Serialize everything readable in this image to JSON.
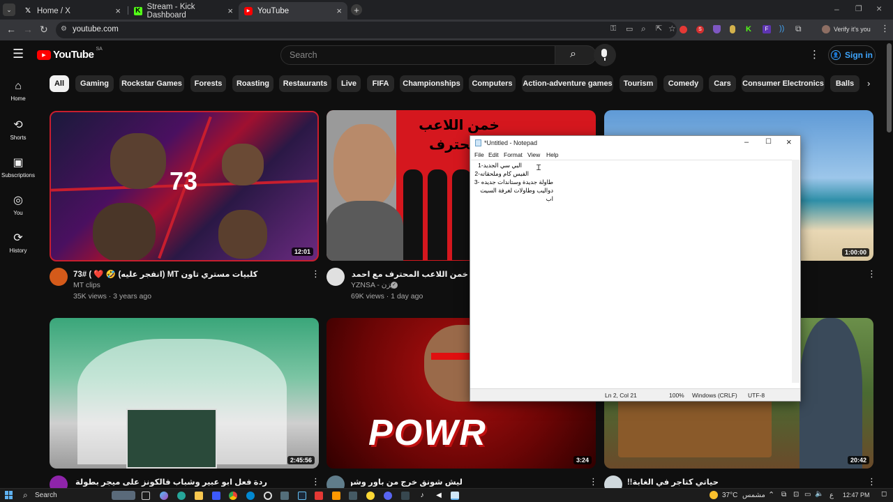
{
  "browser": {
    "tabs": [
      {
        "title": "Home / X",
        "icon": "x-logo-icon"
      },
      {
        "title": "Stream - Kick Dashboard",
        "icon": "kick-logo-icon"
      },
      {
        "title": "YouTube",
        "icon": "youtube-logo-icon"
      }
    ],
    "url": "youtube.com",
    "profile_label": "Verify it's you"
  },
  "youtube": {
    "logo": "YouTube",
    "region": "SA",
    "search_placeholder": "Search",
    "sign_in": "Sign in",
    "sidebar": [
      {
        "label": "Home",
        "icon": "home-icon"
      },
      {
        "label": "Shorts",
        "icon": "shorts-icon"
      },
      {
        "label": "Subscriptions",
        "icon": "subscriptions-icon"
      },
      {
        "label": "You",
        "icon": "you-icon"
      },
      {
        "label": "History",
        "icon": "history-icon"
      }
    ],
    "chips": [
      "All",
      "Gaming",
      "Rockstar Games",
      "Forests",
      "Roasting",
      "Restaurants",
      "Live",
      "FIFA",
      "Championships",
      "Computers",
      "Action-adventure games",
      "Tourism",
      "Comedy",
      "Cars",
      "Consumer Electronics",
      "Balls"
    ],
    "videos": [
      {
        "title": "كلبيات مستري تاون MT (انفجر عليه) 🤣 ❤️ ) #73",
        "channel": "MT clips",
        "meta": "35K views · 3 years ago",
        "duration": "12:01",
        "thumb_text": "73"
      },
      {
        "title": "خمن اللاعب المحترف مع احمد الشرقي ومو اعضاء باور 🔥 🎮 !",
        "channel": "YZNSA - يزن",
        "meta": "69K views · 1 day ago",
        "duration": "",
        "thumb_text": "خمن اللاعب المحترف"
      },
      {
        "title": "",
        "channel": "",
        "meta": "",
        "duration": "1:00:00",
        "thumb_text": ""
      },
      {
        "title": "ردة فعل ابو عبير وشباب فالكونز على ميجر بطولة روكيت ليق 🔥 🟢 🏆",
        "channel": "",
        "meta": "",
        "duration": "2:45:56",
        "thumb_text": ""
      },
      {
        "title": "ليش شونق خرج من باور وشو الي صار!!",
        "channel": "",
        "meta": "",
        "duration": "3:24",
        "thumb_text": "POWR"
      },
      {
        "title": "حياتي كتاجر في الغابة!! 🟢",
        "channel": "",
        "meta": "",
        "duration": "20:42",
        "thumb_text": ""
      }
    ]
  },
  "notepad": {
    "title": "*Untitled - Notepad",
    "menu": [
      "File",
      "Edit",
      "Format",
      "View",
      "Help"
    ],
    "lines": [
      "البي سي الجديد-1",
      "الفيس كام وملحقاته-2",
      "طاولة جديدة وستاندات جديده -3",
      "دواليب وطاولات لغرفة السيت اب"
    ],
    "status": {
      "position": "Ln 2, Col 21",
      "zoom": "100%",
      "line_ending": "Windows (CRLF)",
      "encoding": "UTF-8"
    }
  },
  "taskbar": {
    "search_label": "Search",
    "weather": "37°C",
    "weather_desc": "مشمس",
    "lang": "ع",
    "time": "12:47 PM"
  }
}
